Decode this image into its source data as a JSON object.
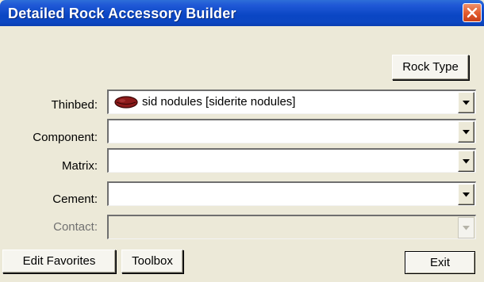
{
  "window": {
    "title": "Detailed Rock Accessory Builder"
  },
  "toolbar": {
    "rock_type_label": "Rock Type"
  },
  "fields": {
    "thinbed": {
      "label": "Thinbed:",
      "value": "sid nodules [siderite nodules]",
      "icon": "siderite-nodule-icon",
      "icon_color": "#8b1a1a"
    },
    "component": {
      "label": "Component:",
      "value": ""
    },
    "matrix": {
      "label": "Matrix:",
      "value": ""
    },
    "cement": {
      "label": "Cement:",
      "value": ""
    },
    "contact": {
      "label": "Contact:",
      "value": "",
      "disabled": true
    }
  },
  "footer": {
    "edit_favorites_label": "Edit Favorites",
    "toolbox_label": "Toolbox",
    "exit_label": "Exit"
  },
  "colors": {
    "title_bar": "#0a46c4",
    "close_button": "#e1592b",
    "window_bg": "#ece9d8"
  }
}
